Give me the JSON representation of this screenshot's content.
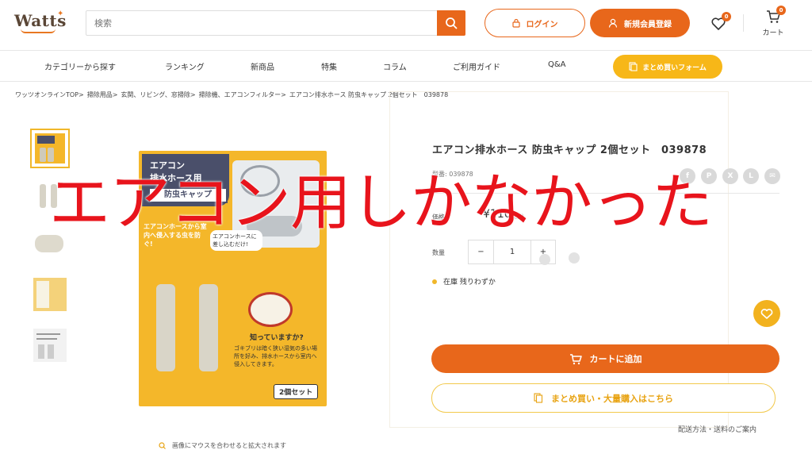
{
  "header": {
    "logo_text": "Watts",
    "search_placeholder": "検索",
    "search_value": "",
    "login_label": "ログイン",
    "register_label": "新規会員登録",
    "favorites_count": "0",
    "cart_count": "0",
    "cart_label": "カート"
  },
  "nav": {
    "items": [
      "カテゴリーから探す",
      "ランキング",
      "新商品",
      "特集",
      "コラム",
      "ご利用ガイド",
      "Q&A"
    ],
    "bulk_form_label": "まとめ買いフォーム"
  },
  "breadcrumb": [
    "ワッツオンラインTOP>",
    "掃除用品>",
    "玄関、リビング、窓掃除>",
    "掃除機、エアコンフィルター>",
    "エアコン排水ホース 防虫キャップ 2個セット　039878"
  ],
  "product": {
    "title": "エアコン排水ホース 防虫キャップ 2個セット　039878",
    "model": "型番: 039878",
    "price_label": "価格",
    "price": "¥110",
    "tax_note": "税込",
    "quantity_label": "数量",
    "quantity": "1",
    "stock_text": "在庫 残りわずか",
    "add_to_cart_label": "カートに追加",
    "bulk_purchase_label": "まとめ買い・大量購入はこちら",
    "shipping_link": "配送方法・送料のご案内",
    "zoom_hint": "画像にマウスを合わせると拡大されます",
    "share_icons": [
      "facebook-icon",
      "pinterest-icon",
      "x-icon",
      "line-icon",
      "mail-icon"
    ]
  },
  "package": {
    "line1": "エアコン",
    "line2": "排水ホース用",
    "badge": "防虫キャップ",
    "left_text": "エアコンホースから室内へ侵入する虫を防ぐ!",
    "insert_text": "エアコンホースに差し込むだけ!",
    "question": "知っていますか?",
    "info": "ゴキブリは暗く狭い湿気の多い場所を好み、排水ホースから室内へ侵入してきます。",
    "count_badge": "2個セット"
  },
  "overlay_caption": "エアコン用しかなかった",
  "colors": {
    "accent": "#e8671b",
    "yellow": "#f7b718",
    "overlay_red": "#e8141c"
  }
}
